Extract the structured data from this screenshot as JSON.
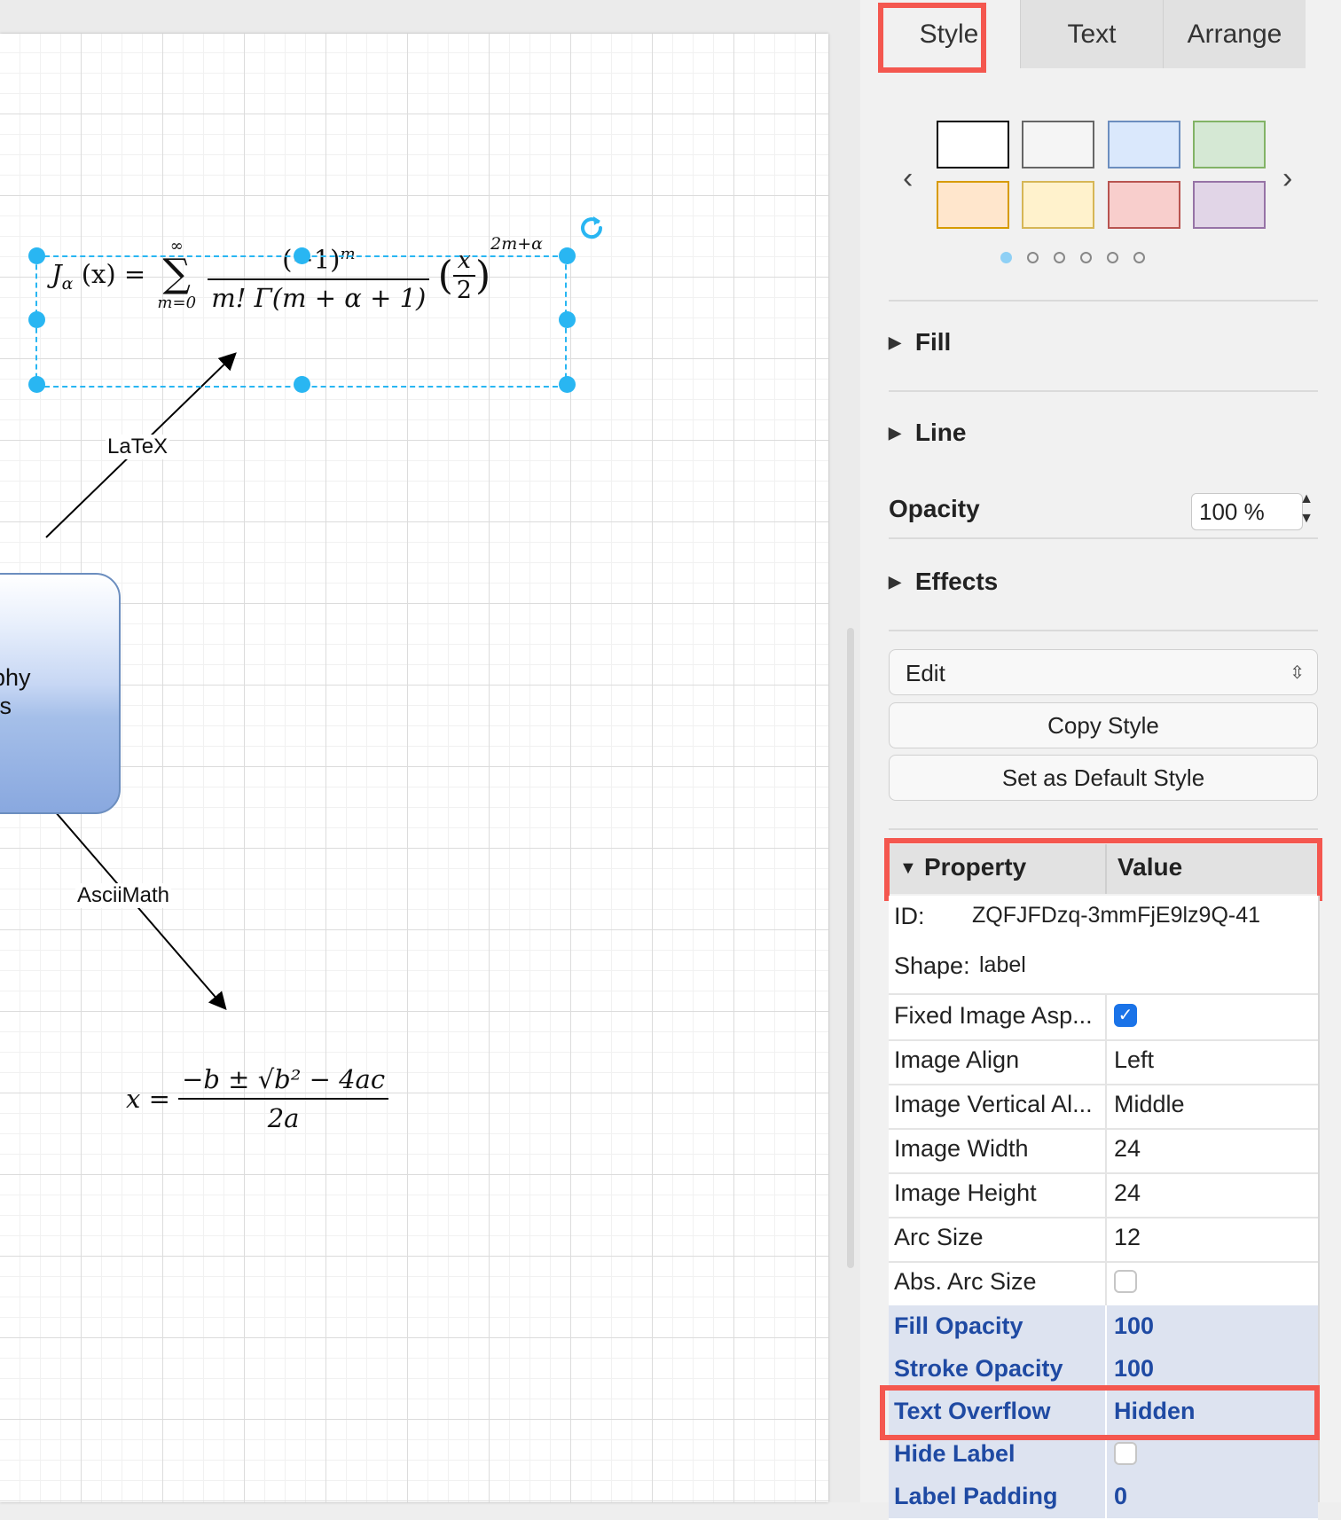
{
  "canvas": {
    "edge_latex_label": "LaTeX",
    "edge_ascii_label": "AsciiMath",
    "shape_text_line1": "graphy",
    "shape_text_line2": "sers",
    "bessel": {
      "lhs": "J",
      "lhs_sub": "α",
      "lhs_arg": "(x) =",
      "sum_top": "∞",
      "sum_sym": "∑",
      "sum_bottom": "m=0",
      "num": "(−1)",
      "num_sup": "m",
      "den": "m! Γ(m + α + 1)",
      "paren_num": "x",
      "paren_den": "2",
      "exp": "2m+α"
    },
    "quadratic": {
      "lhs": "x =",
      "num": "−b ± √b² − 4ac",
      "den": "2a"
    }
  },
  "panel": {
    "tabs": [
      {
        "label": "Style",
        "active": true
      },
      {
        "label": "Text",
        "active": false
      },
      {
        "label": "Arrange",
        "active": false
      }
    ],
    "swatches": [
      {
        "fill": "#ffffff",
        "stroke": "#000000"
      },
      {
        "fill": "#f5f5f5",
        "stroke": "#666666"
      },
      {
        "fill": "#dae8fc",
        "stroke": "#6c8ebf"
      },
      {
        "fill": "#d5e8d4",
        "stroke": "#82b366"
      },
      {
        "fill": "#ffe6cc",
        "stroke": "#d79b00"
      },
      {
        "fill": "#fff2cc",
        "stroke": "#d6b656"
      },
      {
        "fill": "#f8cecc",
        "stroke": "#b85450"
      },
      {
        "fill": "#e1d5e7",
        "stroke": "#9673a6"
      }
    ],
    "swatch_page": 1,
    "swatch_pages": 6,
    "sections": {
      "fill": "Fill",
      "line": "Line",
      "effects": "Effects"
    },
    "opacity": {
      "label": "Opacity",
      "value": "100 %"
    },
    "edit_select": "Edit",
    "copy_style": "Copy Style",
    "set_default": "Set as Default Style",
    "grid": {
      "property": "Property",
      "value": "Value"
    },
    "id": {
      "label": "ID:",
      "value": "ZQFJFDzq-3mmFjE9lz9Q-41"
    },
    "shape": {
      "label": "Shape:",
      "value": "label"
    },
    "rows": [
      {
        "key": "Fixed Image Asp...",
        "type": "check",
        "checked": true
      },
      {
        "key": "Image Align",
        "value": "Left"
      },
      {
        "key": "Image Vertical Al...",
        "value": "Middle"
      },
      {
        "key": "Image Width",
        "value": "24"
      },
      {
        "key": "Image Height",
        "value": "24"
      },
      {
        "key": "Arc Size",
        "value": "12"
      },
      {
        "key": "Abs. Arc Size",
        "type": "check",
        "checked": false
      },
      {
        "key": "Fill Opacity",
        "value": "100",
        "modified": true
      },
      {
        "key": "Stroke Opacity",
        "value": "100",
        "modified": true
      },
      {
        "key": "Text Overflow",
        "value": "Hidden",
        "modified": true
      },
      {
        "key": "Hide Label",
        "type": "check",
        "checked": false,
        "modified": true
      },
      {
        "key": "Label Padding",
        "value": "0",
        "modified": true
      }
    ],
    "highlight_color": "#f4574f",
    "accent_color": "#29b6f2"
  }
}
